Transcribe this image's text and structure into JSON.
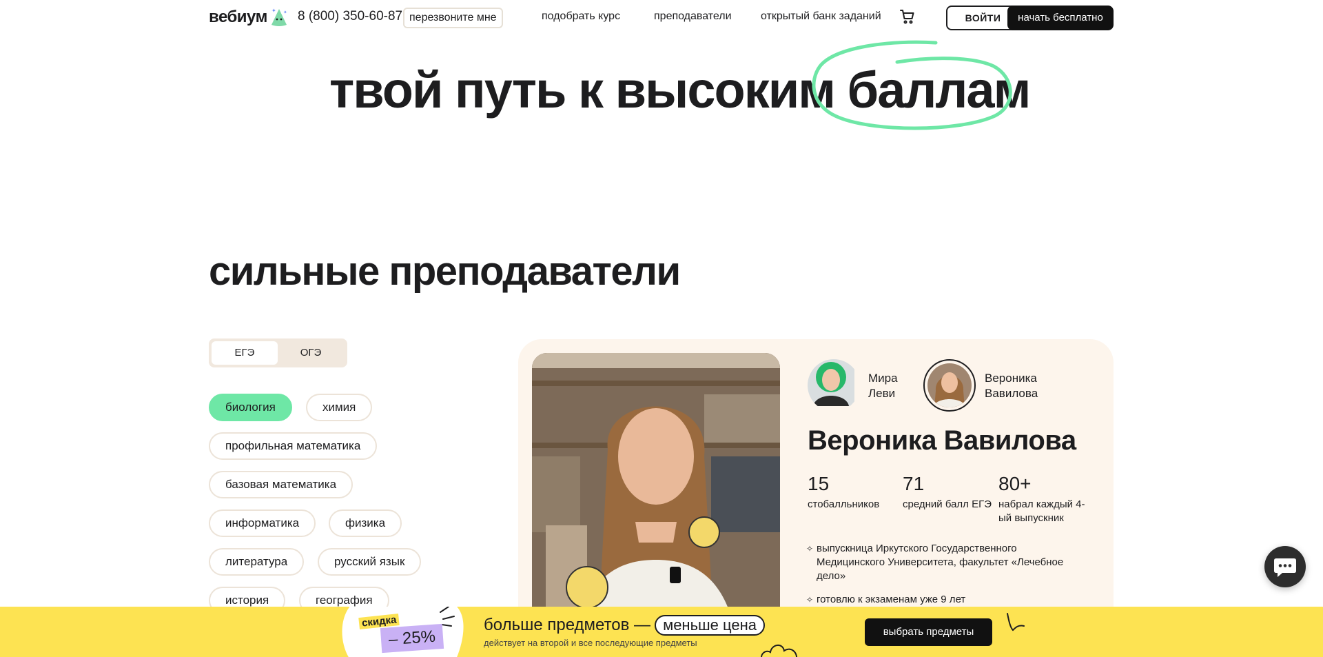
{
  "header": {
    "logo_text": "вебиум",
    "phone": "8 (800) 350-60-87",
    "callback_label": "перезвоните мне",
    "nav": [
      "подобрать курс",
      "преподаватели",
      "открытый банк заданий"
    ],
    "login_label": "ВОЙТИ",
    "start_label": "начать бесплатно"
  },
  "hero": {
    "title_main": "твой путь к высоким",
    "title_highlight": "баллам",
    "accent_color": "#6ee7a6"
  },
  "teachers": {
    "section_title": "сильные преподаватели",
    "exam_tabs": [
      {
        "label": "ЕГЭ",
        "active": true
      },
      {
        "label": "ОГЭ",
        "active": false
      }
    ],
    "subjects": [
      {
        "label": "биология",
        "active": true
      },
      {
        "label": "химия",
        "active": false
      },
      {
        "label": "профильная математика",
        "active": false
      },
      {
        "label": "базовая математика",
        "active": false
      },
      {
        "label": "информатика",
        "active": false
      },
      {
        "label": "физика",
        "active": false
      },
      {
        "label": "литература",
        "active": false
      },
      {
        "label": "русский язык",
        "active": false
      },
      {
        "label": "история",
        "active": false
      },
      {
        "label": "география",
        "active": false
      }
    ],
    "selector": [
      {
        "first": "Мира",
        "last": "Леви",
        "selected": false
      },
      {
        "first": "Вероника",
        "last": "Вавилова",
        "selected": true
      }
    ],
    "current": {
      "name": "Вероника Вавилова",
      "stats": [
        {
          "value": "15",
          "label_1": "стобалльников",
          "label_2": ""
        },
        {
          "value": "71",
          "label_1": "средний балл ЕГЭ",
          "label_2": ""
        },
        {
          "value": "80+",
          "label_1": "набрал каждый 4-",
          "label_2": "ый выпускник"
        }
      ],
      "bullets": [
        {
          "lines": [
            "выпускница Иркутского Государственного",
            "Медицинского Университета, факультет «Лечебное",
            "дело»"
          ]
        },
        {
          "lines": [
            "готовлю к экзаменам уже 9 лет"
          ]
        }
      ]
    }
  },
  "promo": {
    "discount_label": "скидка",
    "discount_value": "– 25%",
    "title": "больше предметов —",
    "title_pill": "меньше цена",
    "subtitle": "действует на второй и все последующие предметы",
    "button_label": "выбрать предметы",
    "bg_color": "#fde352"
  }
}
